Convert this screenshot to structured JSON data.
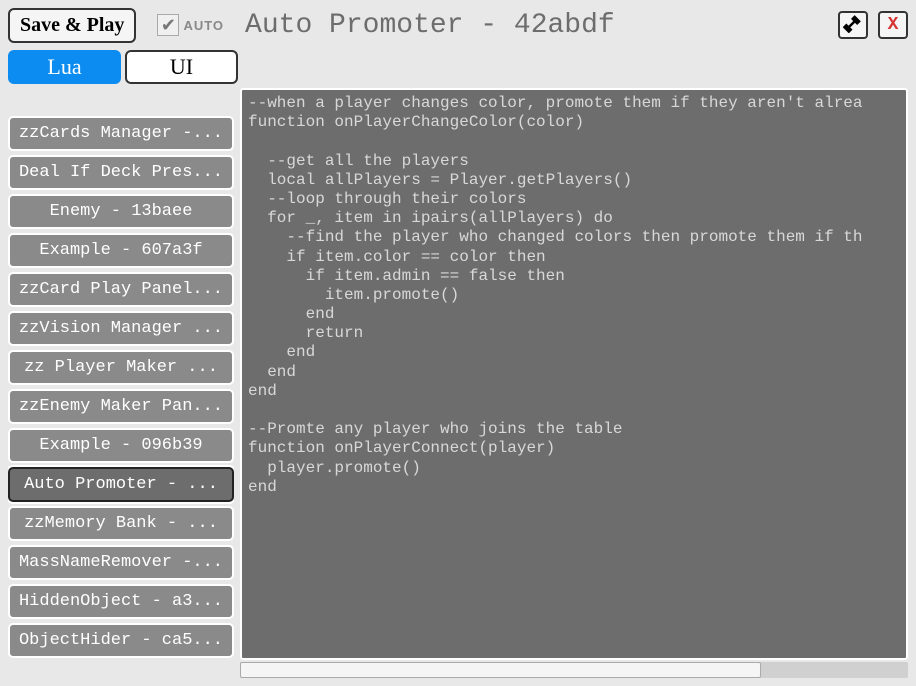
{
  "header": {
    "save_play": "Save & Play",
    "auto_label": "AUTO",
    "auto_checked": true,
    "title": "Auto Promoter - 42abdf"
  },
  "tabs": {
    "lua": "Lua",
    "ui": "UI",
    "active": "lua"
  },
  "sidebar": {
    "items": [
      {
        "label": "zzCards Manager -...",
        "selected": false
      },
      {
        "label": "Deal If Deck Pres...",
        "selected": false
      },
      {
        "label": "Enemy - 13baee",
        "selected": false
      },
      {
        "label": "Example - 607a3f",
        "selected": false
      },
      {
        "label": "zzCard Play Panel...",
        "selected": false
      },
      {
        "label": "zzVision Manager ...",
        "selected": false
      },
      {
        "label": "zz Player Maker ...",
        "selected": false
      },
      {
        "label": "zzEnemy Maker Pan...",
        "selected": false
      },
      {
        "label": "Example - 096b39",
        "selected": false
      },
      {
        "label": "Auto Promoter - ...",
        "selected": true
      },
      {
        "label": "zzMemory Bank - ...",
        "selected": false
      },
      {
        "label": "MassNameRemover -...",
        "selected": false
      },
      {
        "label": "HiddenObject - a3...",
        "selected": false
      },
      {
        "label": "ObjectHider - ca5...",
        "selected": false
      }
    ]
  },
  "code": "--when a player changes color, promote them if they aren't alrea\nfunction onPlayerChangeColor(color)\n\n  --get all the players\n  local allPlayers = Player.getPlayers()\n  --loop through their colors\n  for _, item in ipairs(allPlayers) do\n    --find the player who changed colors then promote them if th\n    if item.color == color then\n      if item.admin == false then\n        item.promote()\n      end\n      return\n    end\n  end\nend\n\n--Promte any player who joins the table\nfunction onPlayerConnect(player)\n  player.promote()\nend"
}
